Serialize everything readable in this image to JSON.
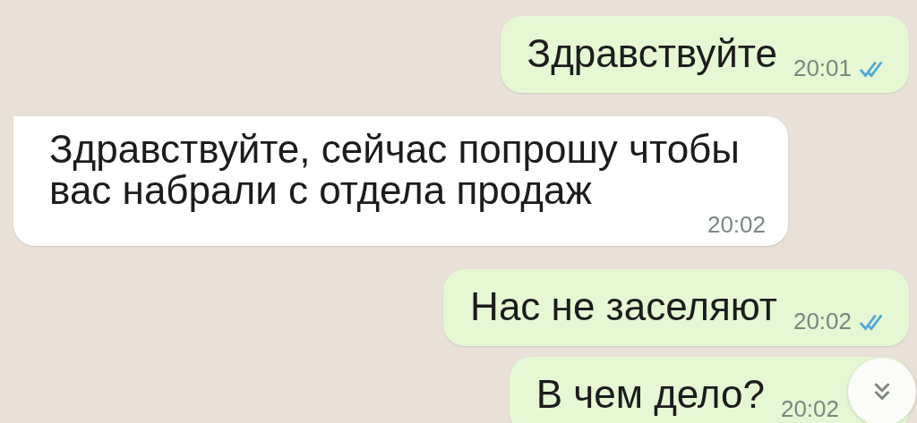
{
  "messages": [
    {
      "kind": "sent",
      "text": "Здравствуйте",
      "time": "20:01",
      "read": true
    },
    {
      "kind": "received",
      "text": "Здравствуйте, сейчас попрошу чтобы вас набрали с отдела продаж",
      "time": "20:02"
    },
    {
      "kind": "sent",
      "text": "Нас не заселяют",
      "time": "20:02",
      "read": true
    },
    {
      "kind": "sent",
      "text": "В чем дело?",
      "time": "20:02"
    }
  ],
  "scroll_down_button": true
}
